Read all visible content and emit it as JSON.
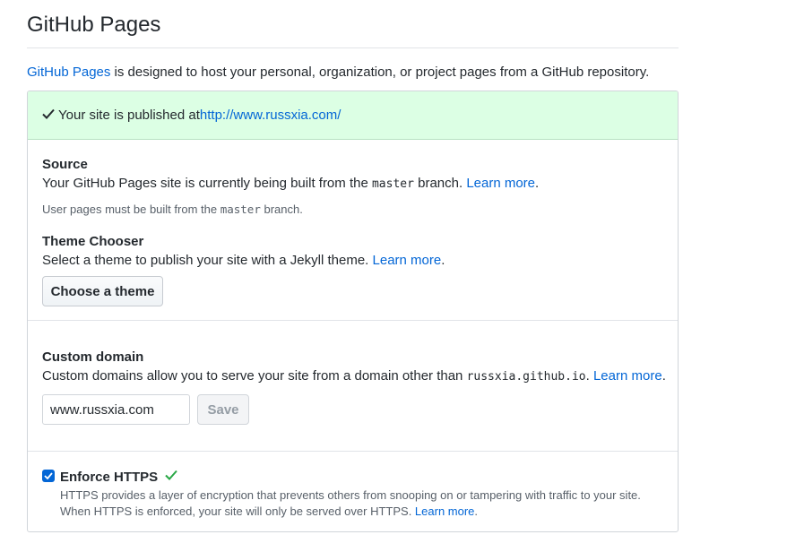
{
  "page": {
    "title": "GitHub Pages",
    "intro_link": "GitHub Pages",
    "intro_text": " is designed to host your personal, organization, or project pages from a GitHub repository."
  },
  "flash": {
    "icon": "check-icon",
    "text": "Your site is published at ",
    "url": "http://www.russxia.com/"
  },
  "source": {
    "heading": "Source",
    "text_before": "Your GitHub Pages site is currently being built from the ",
    "branch": "master",
    "text_after": " branch. ",
    "learn_more": "Learn more",
    "period": ".",
    "note_before": "User pages must be built from the ",
    "note_branch": "master",
    "note_after": " branch."
  },
  "theme": {
    "heading": "Theme Chooser",
    "text": "Select a theme to publish your site with a Jekyll theme. ",
    "learn_more": "Learn more",
    "period": ".",
    "button": "Choose a theme"
  },
  "domain": {
    "heading": "Custom domain",
    "text_before": "Custom domains allow you to serve your site from a domain other than ",
    "default_domain": "russxia.github.io",
    "text_after": ". ",
    "learn_more": "Learn more",
    "period": ".",
    "input_value": "www.russxia.com",
    "save": "Save"
  },
  "https": {
    "label": "Enforce HTTPS",
    "checked": true,
    "status_icon": "check-icon",
    "status_color": "#28a745",
    "desc_line1": "HTTPS provides a layer of encryption that prevents others from snooping on or tampering with traffic to your site.",
    "desc_line2": "When HTTPS is enforced, your site will only be served over HTTPS. ",
    "learn_more": "Learn more",
    "period": "."
  },
  "colors": {
    "link": "#0366d6",
    "success_bg": "#dcffe4",
    "checkbox": "#0366d6"
  }
}
